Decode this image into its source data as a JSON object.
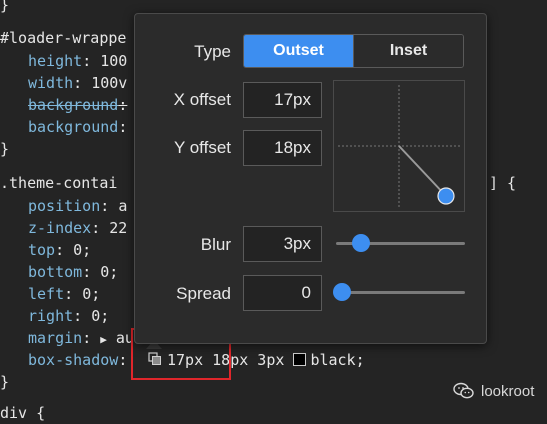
{
  "code": {
    "line0_brace": "}",
    "loader_selector": "#loader-wrappe",
    "loader_height_prop": "height",
    "loader_height_val": "100",
    "loader_width_prop": "width",
    "loader_width_val": "100v",
    "loader_bg1_prop": "background",
    "loader_bg2_prop": "background",
    "close1": "}",
    "theme_selector": ".theme-contai",
    "theme_selector_tail": "] {",
    "position_prop": "position",
    "position_val": "a",
    "zindex_prop": "z-index",
    "zindex_val": "22",
    "top_prop": "top",
    "top_val": "0;",
    "bottom_prop": "bottom",
    "bottom_val": "0;",
    "left_prop": "left",
    "left_val": "0;",
    "right_prop": "right",
    "right_val": "0;",
    "margin_prop": "margin",
    "margin_val": "au",
    "boxshadow_prop": "box-shadow",
    "boxshadow_val": "17px 18px 3px",
    "boxshadow_color": "black;",
    "close2": "}",
    "next_selector": "div {"
  },
  "shadow_editor": {
    "type_label": "Type",
    "type_options": [
      "Outset",
      "Inset"
    ],
    "selected_type": "Outset",
    "x_offset_label": "X offset",
    "x_offset_value": "17px",
    "y_offset_label": "Y offset",
    "y_offset_value": "18px",
    "blur_label": "Blur",
    "blur_value": "3px",
    "spread_label": "Spread",
    "spread_value": "0"
  },
  "watermark": {
    "text": "lookroot",
    "icon": "wechat-icon"
  },
  "colors": {
    "accent": "#3d8ef0",
    "highlight": "#e0262b",
    "property": "#7fb8dc"
  }
}
